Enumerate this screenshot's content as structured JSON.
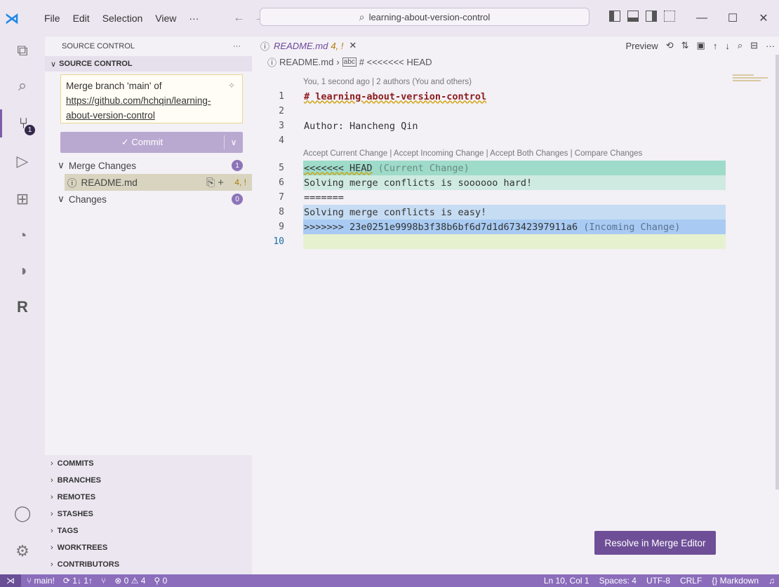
{
  "titlebar": {
    "menus": [
      {
        "label": "File"
      },
      {
        "label": "Edit"
      },
      {
        "label": "Selection"
      },
      {
        "label": "View"
      },
      {
        "label": "···"
      }
    ],
    "search": "learning-about-version-control",
    "window_controls": {
      "minimize": "—",
      "maximize": "☐",
      "close": "✕"
    }
  },
  "activity": {
    "source_control_badge": "1"
  },
  "sidebar": {
    "title": "SOURCE CONTROL",
    "more": "···",
    "section": "SOURCE CONTROL",
    "commit_message": {
      "line1": "Merge branch 'main' of",
      "line2": "https://github.com/hchqin/learning-",
      "line3": "about-version-control"
    },
    "commit_button": "✓ Commit",
    "merge_changes_label": "Merge Changes",
    "merge_changes_count": "1",
    "file": {
      "name": "README.md",
      "status": "4, !"
    },
    "changes_label": "Changes",
    "changes_count": "0",
    "bottom_sections": [
      "COMMITS",
      "BRANCHES",
      "REMOTES",
      "STASHES",
      "TAGS",
      "WORKTREES",
      "CONTRIBUTORS"
    ]
  },
  "editor": {
    "tab": {
      "title": "README.md",
      "status": "4, !"
    },
    "preview_label": "Preview",
    "breadcrumb": {
      "file": "README.md",
      "symbol": "# <<<<<<< HEAD"
    },
    "blame": "You, 1 second ago | 2 authors (You and others)",
    "conflict_actions": "Accept Current Change | Accept Incoming Change | Accept Both Changes | Compare Changes",
    "lines": [
      {
        "num": "1",
        "text": "# learning-about-version-control"
      },
      {
        "num": "2",
        "text": ""
      },
      {
        "num": "3",
        "text": "Author: Hancheng Qin"
      },
      {
        "num": "4",
        "text": ""
      },
      {
        "num": "5",
        "marker": "<<<<<<< HEAD",
        "label": " (Current Change)"
      },
      {
        "num": "6",
        "text": "Solving merge conflicts is soooooo hard!"
      },
      {
        "num": "7",
        "text": "======="
      },
      {
        "num": "8",
        "text": "Solving merge conflicts is easy!"
      },
      {
        "num": "9",
        "marker": ">>>>>>> 23e0251e9998b3f38b6bf6d7d1d67342397911a6",
        "label": " (Incoming Change)"
      },
      {
        "num": "10",
        "text": ""
      }
    ],
    "resolve_button": "Resolve in Merge Editor"
  },
  "statusbar": {
    "branch": "main!",
    "sync": "1↓ 1↑",
    "errors": "0",
    "warnings": "4",
    "ports": "0",
    "position": "Ln 10, Col 1",
    "spaces": "Spaces: 4",
    "encoding": "UTF-8",
    "eol": "CRLF",
    "language": "Markdown"
  }
}
